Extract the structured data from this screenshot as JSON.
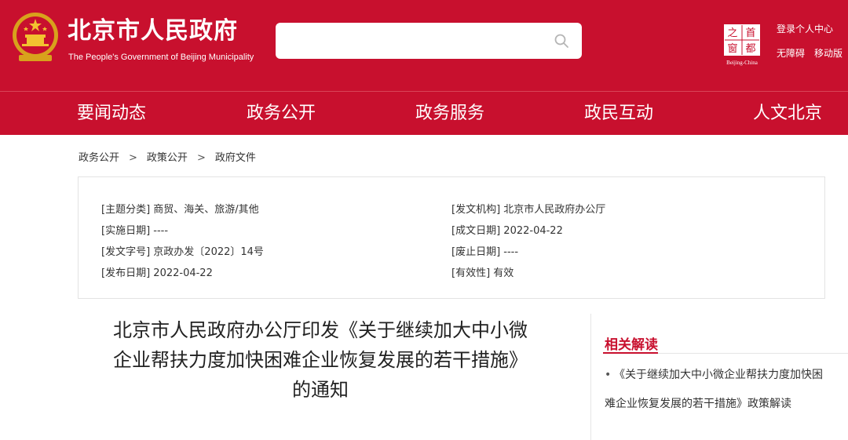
{
  "header": {
    "title": "北京市人民政府",
    "subtitle": "The People's Government of Beijing Municipality",
    "search_placeholder": "",
    "login_label": "登录个人中心",
    "access_label": "无障碍",
    "mobile_label": "移动版",
    "capital_logo": {
      "chars": [
        "首",
        "都",
        "之",
        "窗"
      ],
      "caption": "Beijing-China"
    },
    "brand_color": "#c8102e"
  },
  "nav": {
    "items": [
      "要闻动态",
      "政务公开",
      "政务服务",
      "政民互动",
      "人文北京"
    ]
  },
  "breadcrumb": {
    "items": [
      "政务公开",
      "政策公开",
      "政府文件"
    ],
    "separator": ">"
  },
  "meta": {
    "topic_key": "[主题分类]",
    "topic_value": "商贸、海关、旅游/其他",
    "issuer_key": "[发文机构]",
    "issuer_value": "北京市人民政府办公厅",
    "effective_key": "[实施日期]",
    "effective_value": "----",
    "written_key": "[成文日期]",
    "written_value": "2022-04-22",
    "docno_key": "[发文字号]",
    "docno_value": "京政办发〔2022〕14号",
    "repeal_key": "[废止日期]",
    "repeal_value": "----",
    "publish_key": "[发布日期]",
    "publish_value": "2022-04-22",
    "validity_key": "[有效性]",
    "validity_value": "有效"
  },
  "article": {
    "title_line1": "北京市人民政府办公厅印发《关于继续加大中小微",
    "title_line2": "企业帮扶力度加快困难企业恢复发展的若干措施》",
    "title_line3": "的通知"
  },
  "related": {
    "heading": "相关解读",
    "items": [
      "《关于继续加大中小微企业帮扶力度加快困难企业恢复发展的若干措施》政策解读"
    ],
    "bullet": "•"
  }
}
